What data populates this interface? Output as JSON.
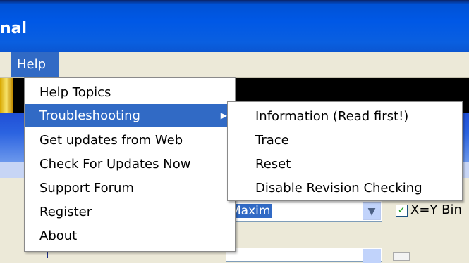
{
  "window": {
    "title_fragment": "nal"
  },
  "menubar": {
    "help": "Help"
  },
  "help_menu": {
    "items": [
      {
        "label": "Help Topics"
      },
      {
        "label": "Troubleshooting",
        "has_submenu": true,
        "highlighted": true
      },
      {
        "label": "Get updates from Web"
      },
      {
        "label": "Check For Updates Now"
      },
      {
        "label": "Support Forum"
      },
      {
        "label": "Register"
      },
      {
        "label": "About"
      }
    ]
  },
  "troubleshooting_submenu": {
    "items": [
      {
        "label": "Information (Read first!)"
      },
      {
        "label": "Trace"
      },
      {
        "label": "Reset"
      },
      {
        "label": "Disable Revision Checking"
      }
    ]
  },
  "background": {
    "combo_value": "Maxim",
    "checkbox_label": "X=Y Bin",
    "checkbox_checked": true
  },
  "colors": {
    "highlight": "#316ac5",
    "titlebar": "#0058e6"
  },
  "icons": {
    "submenu_arrow": "triangle-right-icon",
    "combo_arrow": "chevron-down-icon",
    "check": "checkmark-icon"
  }
}
